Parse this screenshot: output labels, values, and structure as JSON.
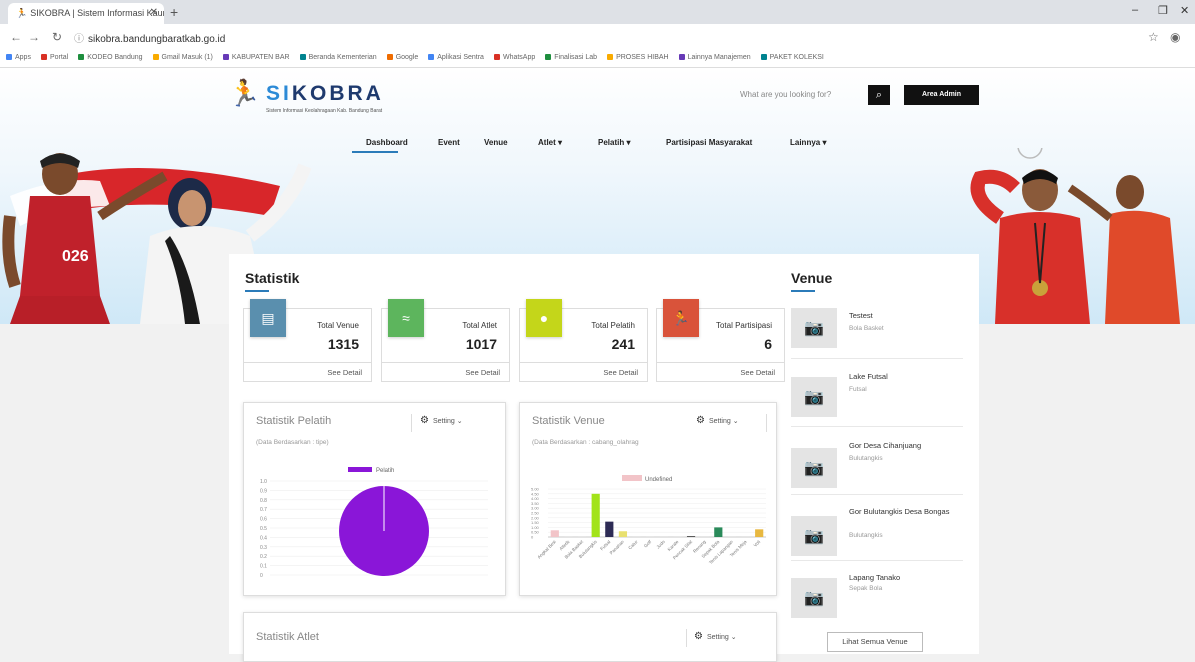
{
  "browser": {
    "tab_title": "SIKOBRA | Sistem Informasi Kaum",
    "url": "sikobra.bandungbaratkab.go.id",
    "bookmarks": [
      "Apps",
      "Portal",
      "KODEO Bandung",
      "Gmail Masuk (1)",
      "KABUPATEN BAR",
      "Beranda Kementerian",
      "Google",
      "Aplikasi Sentra",
      "WhatsApp",
      "Finalisasi Lab",
      "PROSES HIBAH",
      "Lainnya Manajemen",
      "PAKET KOLEKSI"
    ]
  },
  "header": {
    "logo_prefix": "SI",
    "logo_rest": "KOBRA",
    "logo_sub": "Sistem Informasi Keolahragaan Kab. Bandung Barat",
    "search_placeholder": "What are you looking for?",
    "area_button": "Area Admin"
  },
  "nav": [
    {
      "label": "Dashboard"
    },
    {
      "label": "Event"
    },
    {
      "label": "Venue"
    },
    {
      "label": "Atlet ▾"
    },
    {
      "label": "Pelatih ▾"
    },
    {
      "label": "Partisipasi Masyarakat"
    },
    {
      "label": "Lainnya ▾"
    }
  ],
  "statistik": {
    "title": "Statistik",
    "cards": [
      {
        "label": "Total Venue",
        "value": "1315",
        "detail": "See Detail",
        "icon": "venue-icon",
        "color": "#5a8fae"
      },
      {
        "label": "Total Atlet",
        "value": "1017",
        "detail": "See Detail",
        "icon": "swimmer-icon",
        "color": "#5db55d"
      },
      {
        "label": "Total Pelatih",
        "value": "241",
        "detail": "See Detail",
        "icon": "coach-icon",
        "color": "#c4d61a"
      },
      {
        "label": "Total Partisipasi",
        "value": "6",
        "detail": "See Detail",
        "icon": "runner-icon",
        "color": "#d9533a"
      }
    ]
  },
  "pelatih_card": {
    "title": "Statistik Pelatih",
    "subtitle": "(Data Berdasarkan : tipe)",
    "setting": "Setting"
  },
  "venue_card": {
    "title": "Statistik Venue",
    "subtitle": "(Data Berdasarkan : cabang_olahrag",
    "setting": "Setting"
  },
  "atlet_card": {
    "title": "Statistik Atlet",
    "setting": "Setting"
  },
  "venue_list": {
    "title": "Venue",
    "items": [
      {
        "name": "Testest",
        "type": "Bola Basket"
      },
      {
        "name": "Lake Futsal",
        "type": "Futsal"
      },
      {
        "name": "Gor Desa Cihanjuang",
        "type": "Bulutangkis"
      },
      {
        "name": "Gor Bulutangkis Desa Bongas",
        "type": "Bulutangkis"
      },
      {
        "name": "Lapang Tanako",
        "type": "Sepak Bola"
      }
    ],
    "all_button": "Lihat Semua Venue"
  },
  "chart_data": [
    {
      "type": "pie",
      "legend": [
        "Pelatih"
      ],
      "yticks": [
        "1.0",
        "0.9",
        "0.8",
        "0.7",
        "0.6",
        "0.5",
        "0.4",
        "0.3",
        "0.2",
        "0.1",
        "0"
      ],
      "slices": [
        {
          "label": "Pelatih",
          "value": 1.0,
          "color": "#8a16d8"
        }
      ]
    },
    {
      "type": "bar",
      "legend": [
        "Undefined"
      ],
      "ylim": [
        0,
        5
      ],
      "yticks": [
        "5.00",
        "4.50",
        "4.00",
        "3.50",
        "3.00",
        "2.50",
        "2.00",
        "1.50",
        "1.00",
        "0.50",
        "0"
      ],
      "categories": [
        "Angkat Besi",
        "Atletik",
        "Bola Basket",
        "Bulutangkis",
        "Futsal",
        "Panahan",
        "Catur",
        "Golf",
        "Judo",
        "Karate",
        "Pencak Silat",
        "Renang",
        "Sepak Bola",
        "Tenis Lapangan",
        "Tenis Meja",
        "Voli"
      ],
      "values": [
        0.7,
        0.05,
        0.05,
        4.5,
        1.6,
        0.6,
        0.05,
        0.05,
        0.05,
        0.05,
        0.1,
        0.05,
        1.0,
        0.05,
        0.05,
        0.8
      ],
      "colors": [
        "#f2c4c8",
        "#cfcfcf",
        "#cfcfcf",
        "#a2e31a",
        "#2d2b55",
        "#e8e070",
        "#cfcfcf",
        "#cfcfcf",
        "#cfcfcf",
        "#cfcfcf",
        "#555555",
        "#cfcfcf",
        "#2a8a5a",
        "#cfcfcf",
        "#cfcfcf",
        "#e8b840"
      ]
    }
  ]
}
